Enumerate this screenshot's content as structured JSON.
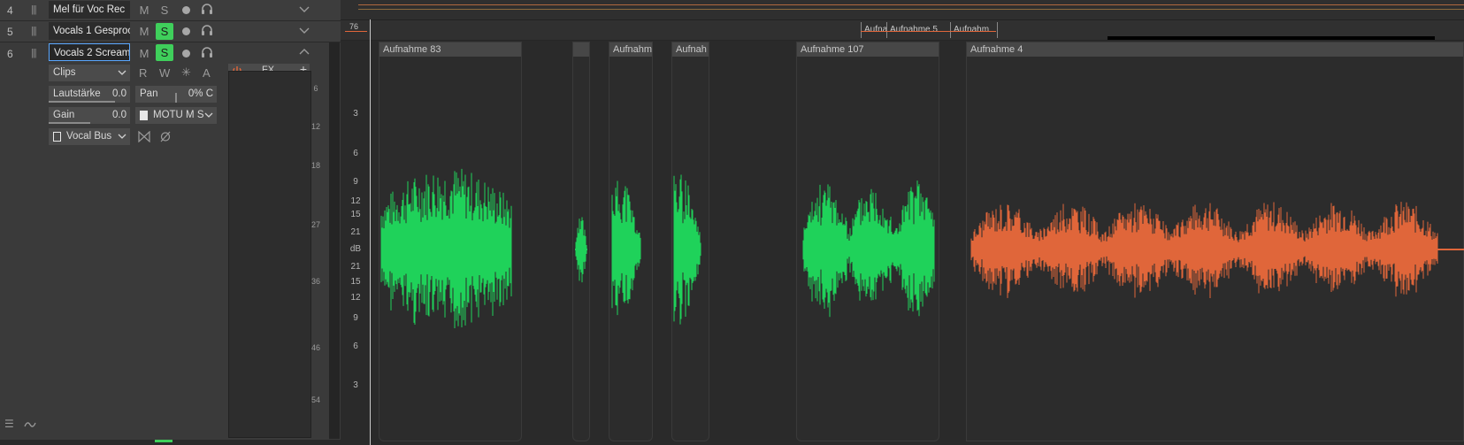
{
  "tracks": [
    {
      "number": "4",
      "name": "Mel für Voc Rec",
      "mute": "M",
      "solo": "S",
      "solo_on": false
    },
    {
      "number": "5",
      "name": "Vocals 1 Gesproc",
      "mute": "M",
      "solo": "S",
      "solo_on": true
    },
    {
      "number": "6",
      "name": "Vocals 2 Scream:",
      "mute": "M",
      "solo": "S",
      "solo_on": true
    }
  ],
  "selected_track": {
    "view_select": "Clips",
    "automation": [
      "R",
      "W",
      "✳",
      "A"
    ],
    "volume_label": "Lautstärke",
    "volume_value": "0.0",
    "pan_label": "Pan",
    "pan_value": "0% C",
    "gain_label": "Gain",
    "gain_value": "0.0",
    "input": "MOTU M S",
    "output": "Vocal Bus",
    "fx_label": "FX",
    "fx_add": "+"
  },
  "meter_scale": [
    "6",
    "12",
    "18",
    "27",
    "36",
    "46",
    "54"
  ],
  "db_scale": [
    "3",
    "6",
    "9",
    "12",
    "15",
    "21",
    "dB",
    "21",
    "15",
    "12",
    "9",
    "6",
    "3"
  ],
  "ruler": {
    "marker": "76"
  },
  "top_clips": [
    "Aufna",
    "Aufnahme 5",
    "Aufnahm"
  ],
  "clips": [
    {
      "name": "Aufnahme 83",
      "color": "#1fd25a"
    },
    {
      "name": "",
      "color": "#1fd25a"
    },
    {
      "name": "Aufnahm",
      "color": "#1fd25a"
    },
    {
      "name": "Aufnah",
      "color": "#1fd25a"
    },
    {
      "name": "Aufnahme 107",
      "color": "#1fd25a"
    },
    {
      "name": "Aufnahme 4",
      "color": "#e0663a"
    }
  ],
  "colors": {
    "accent": "#5aa7ff",
    "solo": "#3fcf5b",
    "green_wave": "#1fd25a",
    "orange_wave": "#e0663a",
    "playhead": "#c9c9c9"
  }
}
